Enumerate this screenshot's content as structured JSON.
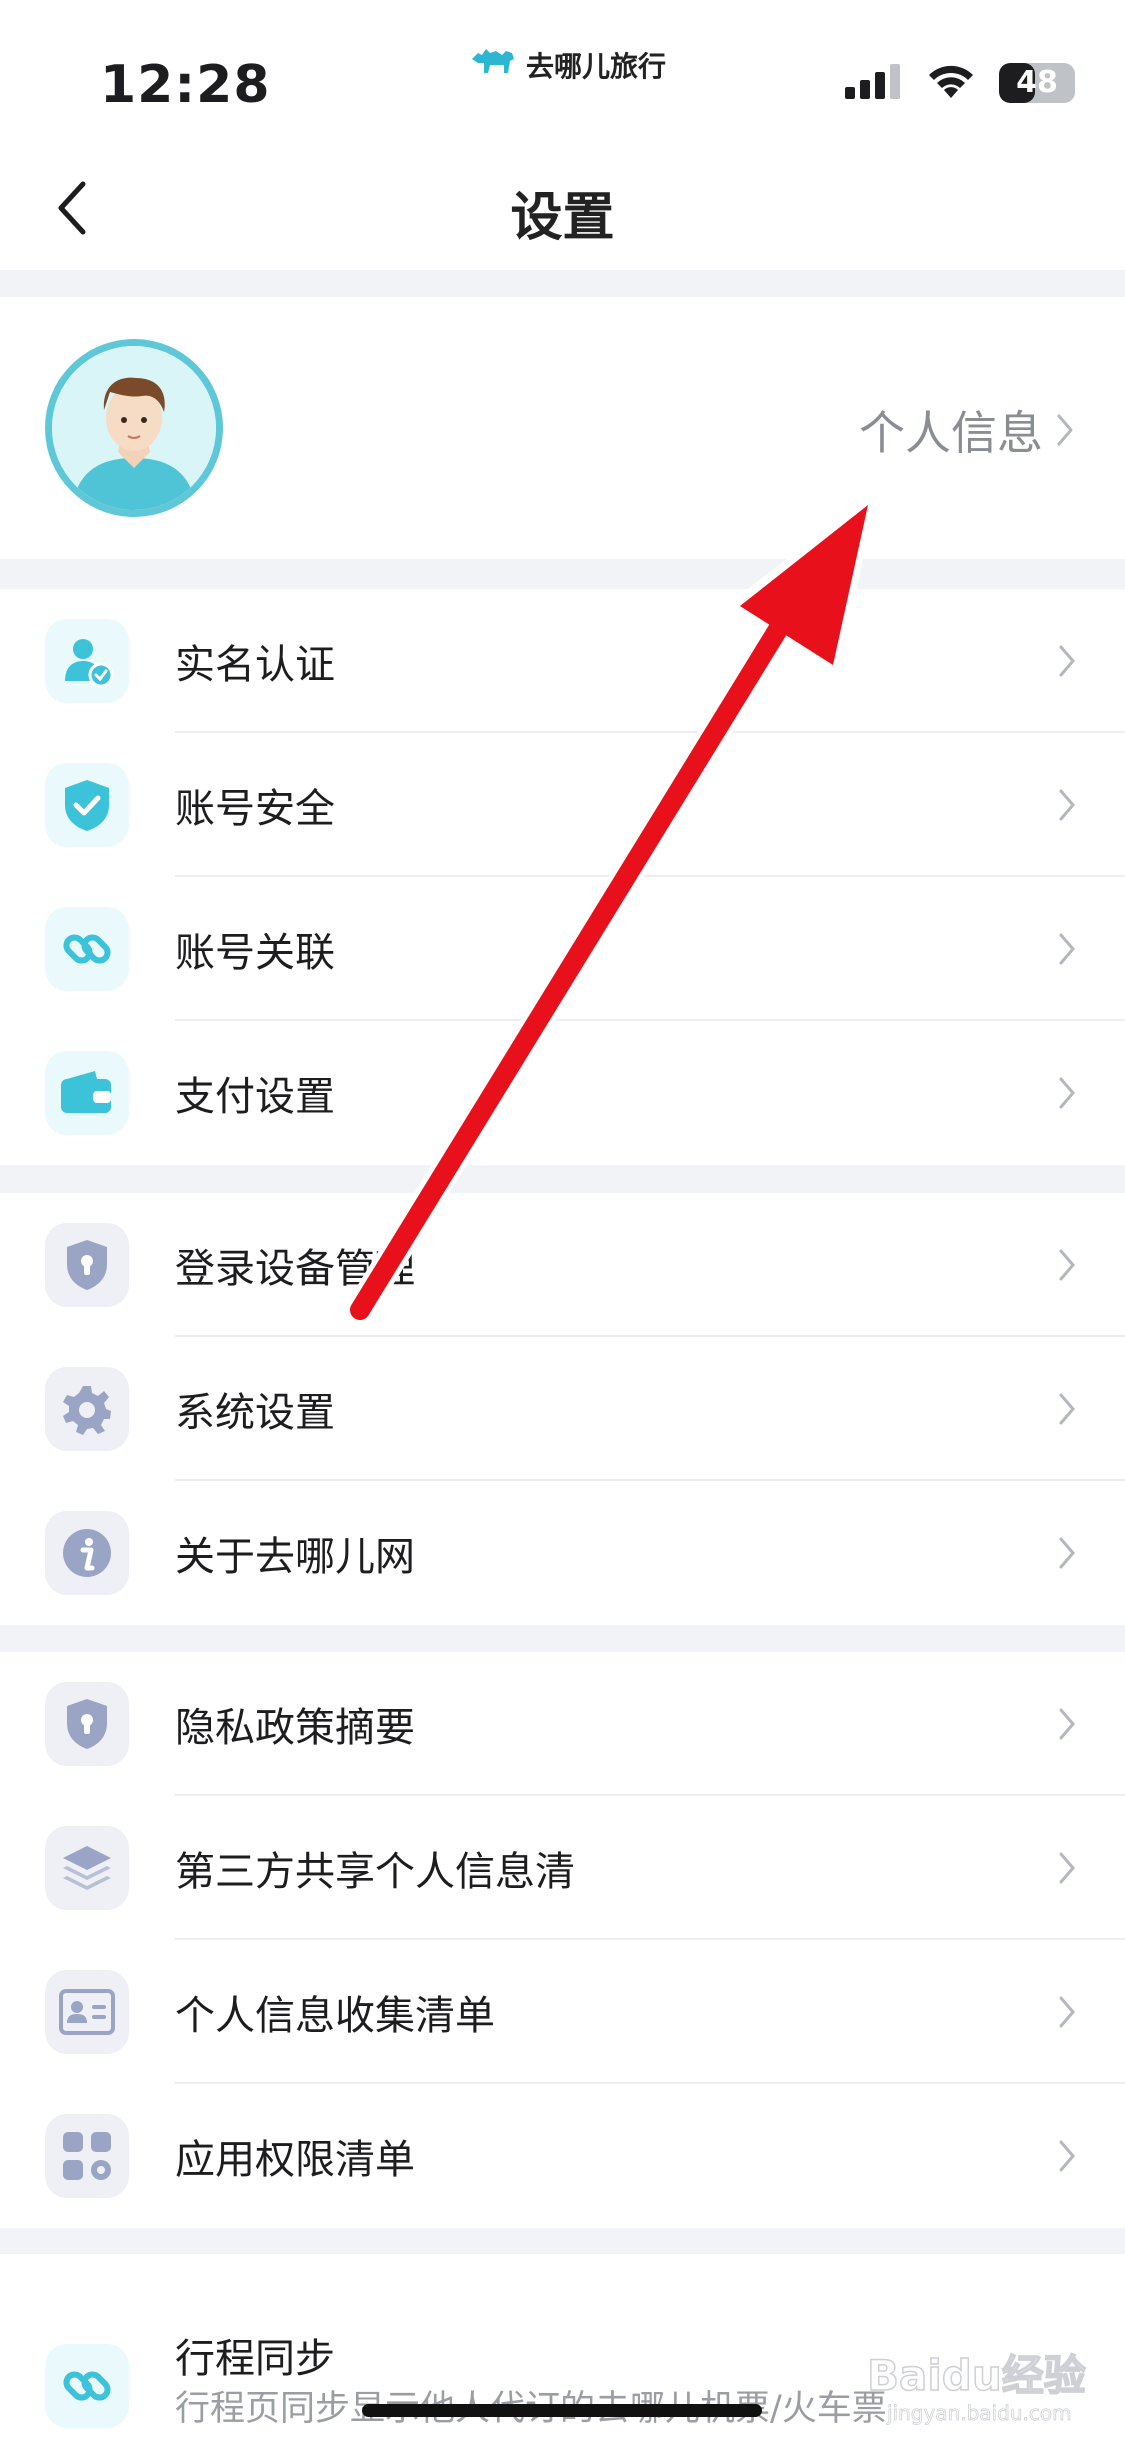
{
  "status_bar": {
    "time": "12:28",
    "brand": "去哪儿旅行",
    "battery": "48",
    "battery_level": 0.48
  },
  "nav": {
    "title": "设置"
  },
  "profile": {
    "link_label": "个人信息"
  },
  "groups": [
    {
      "items": [
        {
          "label": "实名认证",
          "icon": "user-verified-icon"
        },
        {
          "label": "账号安全",
          "icon": "shield-check-icon"
        },
        {
          "label": "账号关联",
          "icon": "link-icon"
        },
        {
          "label": "支付设置",
          "icon": "wallet-icon"
        }
      ]
    },
    {
      "items": [
        {
          "label": "登录设备管理",
          "icon": "lock-shield-icon"
        },
        {
          "label": "系统设置",
          "icon": "gear-icon"
        },
        {
          "label": "关于去哪儿网",
          "icon": "info-icon"
        }
      ]
    },
    {
      "items": [
        {
          "label": "隐私政策摘要",
          "icon": "lock-shield-icon"
        },
        {
          "label": "第三方共享个人信息清",
          "icon": "layers-icon"
        },
        {
          "label": "个人信息收集清单",
          "icon": "id-card-icon"
        },
        {
          "label": "应用权限清单",
          "icon": "apps-icon"
        }
      ]
    }
  ],
  "sync": {
    "title": "行程同步",
    "description": "行程页同步显示他人代订的去哪儿机票/火车票"
  },
  "watermark": {
    "text": "Baidu经验",
    "subtext": "jingyan.baidu.com"
  },
  "colors": {
    "accent_teal": "#3cc2d9",
    "icon_gray": "#9aa4c4",
    "annotation_arrow": "#e8101a"
  }
}
